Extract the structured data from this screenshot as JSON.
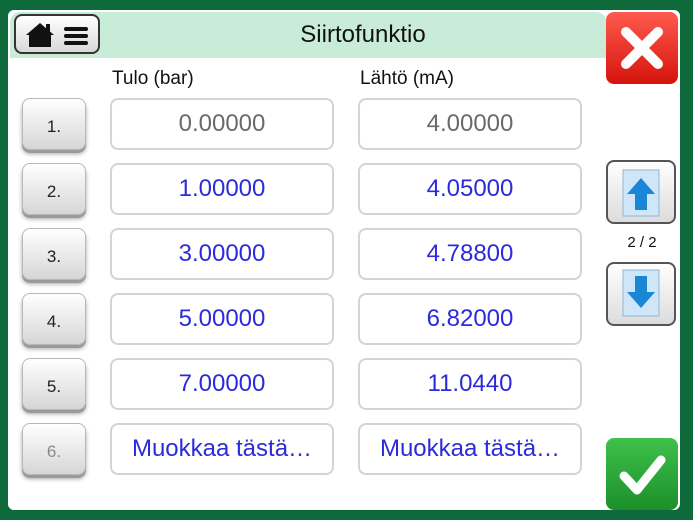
{
  "header": {
    "title": "Siirtofunktio"
  },
  "columns": {
    "input": "Tulo (bar)",
    "output": "Lähtö (mA)"
  },
  "rows": [
    {
      "label": "1.",
      "input": "0.00000",
      "output": "4.00000"
    },
    {
      "label": "2.",
      "input": "1.00000",
      "output": "4.05000"
    },
    {
      "label": "3.",
      "input": "3.00000",
      "output": "4.78800"
    },
    {
      "label": "4.",
      "input": "5.00000",
      "output": "6.82000"
    },
    {
      "label": "5.",
      "input": "7.00000",
      "output": "11.0440"
    },
    {
      "label": "6.",
      "input": "Muokkaa tästä…",
      "output": "Muokkaa tästä…"
    }
  ],
  "pager": {
    "text": "2 / 2"
  },
  "icons": {
    "home": "home-menu-icon",
    "cancel": "close-icon",
    "ok": "checkmark-icon",
    "up": "arrow-up-icon",
    "down": "arrow-down-icon"
  },
  "colors": {
    "frame": "#0e6a3a",
    "accent": "#c9ecd9",
    "cancel": "#e0241a",
    "ok": "#2aa437",
    "value": "#2b2bdb"
  }
}
